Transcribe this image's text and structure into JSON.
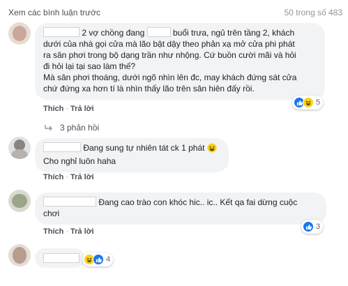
{
  "header": {
    "view_previous": "Xem các bình luận trước",
    "count": "50 trong số 483"
  },
  "comments": [
    {
      "lines": [
        "2 vợ chồng đang",
        "buổi trưa, ngủ trên tầng 2, khách",
        "dưới của nhà gọi cửa mà lão bật dậy theo phản xạ mở cửa phi phát",
        "ra sân phơi trong bộ dạng trần như nhộng. Cứ buồn cười mãi và hỏi",
        "đi hỏi lại tại sao làm thế?",
        "Mà sân phơi thoáng, dưới ngõ nhìn lên đc, may khách đứng sát cửa",
        "chứ đứng xa hơn tí là nhìn thấy lão trên sân hiên đấy rồi."
      ],
      "like": "Thích",
      "reply": "Trả lời",
      "reactions": [
        "like",
        "haha"
      ],
      "reaction_count": "5"
    },
    {
      "lines": [
        "Đang sung tự nhiên tát ck 1 phát",
        "Cho nghỉ luôn haha"
      ],
      "like": "Thích",
      "reply": "Trả lời"
    },
    {
      "lines": [
        "Đang cao trào con khóc hic.. ic.. Kết qa fai dừng cuộc",
        "chơi"
      ],
      "like": "Thích",
      "reply": "Trả lời",
      "reactions": [
        "like"
      ],
      "reaction_count": "3"
    },
    {
      "lines": [],
      "reactions": [
        "haha",
        "like"
      ],
      "reaction_count": "4"
    }
  ],
  "replies_toggle": "3 phản hồi",
  "colors": {
    "bubble": "#f2f3f5",
    "like_blue": "#1877f2",
    "haha_yellow": "#f7d21a",
    "text": "#1c1e21",
    "muted": "#90949c"
  },
  "icons": [
    "reply-arrow-icon",
    "like-icon",
    "haha-icon",
    "laugh-emoji-icon"
  ]
}
